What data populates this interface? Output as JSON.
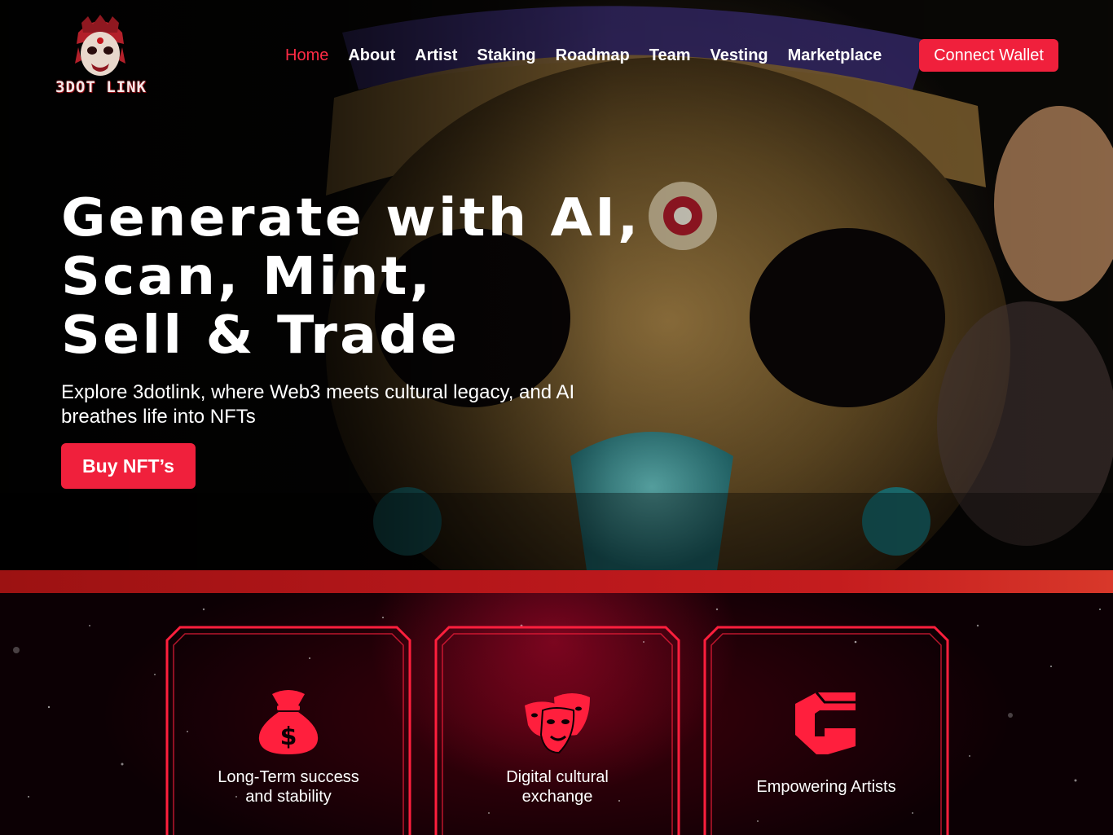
{
  "brand": {
    "logo_text": "3DOT LINK"
  },
  "nav": {
    "items": [
      {
        "label": "Home",
        "active": true
      },
      {
        "label": "About",
        "active": false
      },
      {
        "label": "Artist",
        "active": false
      },
      {
        "label": "Staking",
        "active": false
      },
      {
        "label": "Roadmap",
        "active": false
      },
      {
        "label": "Team",
        "active": false
      },
      {
        "label": "Vesting",
        "active": false
      },
      {
        "label": "Marketplace",
        "active": false
      }
    ],
    "connect_label": "Connect Wallet"
  },
  "hero": {
    "headline_lines": [
      "Generate with AI,",
      "Scan, Mint,",
      "Sell & Trade"
    ],
    "subtitle": "Explore 3dotlink, where Web3 meets cultural legacy, and AI breathes life into NFTs",
    "cta_label": "Buy NFT’s"
  },
  "features": [
    {
      "icon": "money-bag-icon",
      "label_lines": [
        "Long-Term success",
        "and stability"
      ]
    },
    {
      "icon": "theater-masks-icon",
      "label_lines": [
        "Digital cultural",
        "exchange"
      ]
    },
    {
      "icon": "artist-logo-icon",
      "label_lines": [
        "Empowering Artists"
      ]
    }
  ],
  "colors": {
    "accent": "#f0203c",
    "nav_active": "#ff2b45",
    "strip": "#b4161a",
    "card_border": "#ff1f3d"
  }
}
